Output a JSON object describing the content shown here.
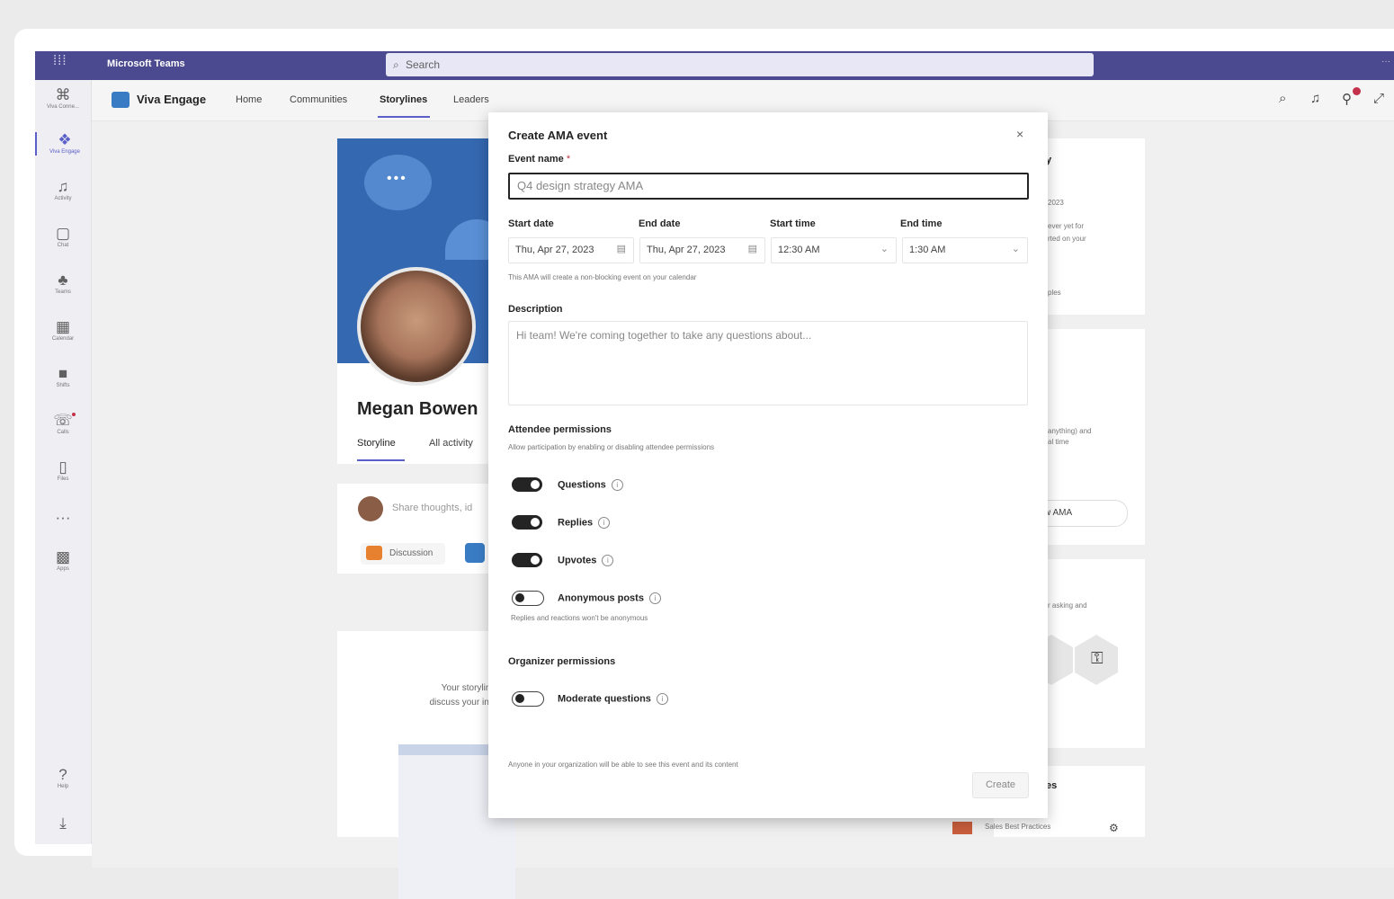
{
  "teams": {
    "title": "Microsoft Teams",
    "search_placeholder": "Search",
    "more": "···",
    "search_icon": "search-icon"
  },
  "rail": [
    {
      "label": "Viva Conne...",
      "icon": "⌘"
    },
    {
      "label": "Viva Engage",
      "icon": "❖"
    },
    {
      "label": "Activity",
      "icon": "♫"
    },
    {
      "label": "Chat",
      "icon": "▢"
    },
    {
      "label": "Teams",
      "icon": "♣"
    },
    {
      "label": "Calendar",
      "icon": "▦"
    },
    {
      "label": "Shifts",
      "icon": "■"
    },
    {
      "label": "Calls",
      "icon": "☏"
    },
    {
      "label": "Files",
      "icon": "▯"
    },
    {
      "label": "",
      "icon": "···"
    },
    {
      "label": "Apps",
      "icon": "▩"
    },
    {
      "label": "Help",
      "icon": "?"
    },
    {
      "label": "",
      "icon": "⤓"
    }
  ],
  "engage": {
    "name": "Viva Engage",
    "nav": [
      "Home",
      "Communities",
      "Storylines",
      "Leaders"
    ],
    "active_nav": "Storylines"
  },
  "profile": {
    "name": "Megan Bowen",
    "tabs": [
      "Storyline",
      "All activity"
    ],
    "composer_placeholder": "Share thoughts, id",
    "chip_label": "Discussion",
    "empty_text": "Your storyline is\ndiscuss your intere"
  },
  "right": {
    "card1": [
      "y",
      "2023",
      "ever yet for",
      "rted on your",
      "ples"
    ],
    "card2": [
      "anything) and",
      "al time",
      "w AMA"
    ],
    "card3": [
      "r asking and"
    ],
    "card4": [
      "es",
      "Sales Best Practices"
    ]
  },
  "modal": {
    "title": "Create AMA event",
    "close": "×",
    "event_name_label": "Event name",
    "required_mark": "*",
    "event_name_placeholder": "Q4 design strategy AMA",
    "start_date_label": "Start date",
    "end_date_label": "End date",
    "start_time_label": "Start time",
    "end_time_label": "End time",
    "start_date": "Thu, Apr 27, 2023",
    "end_date": "Thu, Apr 27, 2023",
    "start_time": "12:30 AM",
    "end_time": "1:30 AM",
    "calendar_note": "This AMA will create a non-blocking event on your calendar",
    "description_label": "Description",
    "description_placeholder": "Hi team! We're coming together to take any questions about...",
    "attendee_title": "Attendee permissions",
    "attendee_sub": "Allow participation by enabling or disabling attendee permissions",
    "toggles": [
      {
        "label": "Questions",
        "on": true
      },
      {
        "label": "Replies",
        "on": true
      },
      {
        "label": "Upvotes",
        "on": true
      },
      {
        "label": "Anonymous posts",
        "on": false
      }
    ],
    "anonymous_note": "Replies and reactions won't be anonymous",
    "organizer_title": "Organizer permissions",
    "organizer_toggle": {
      "label": "Moderate questions",
      "on": false
    },
    "footer_note": "Anyone in your organization will be able to see this event and its content",
    "create_label": "Create"
  }
}
